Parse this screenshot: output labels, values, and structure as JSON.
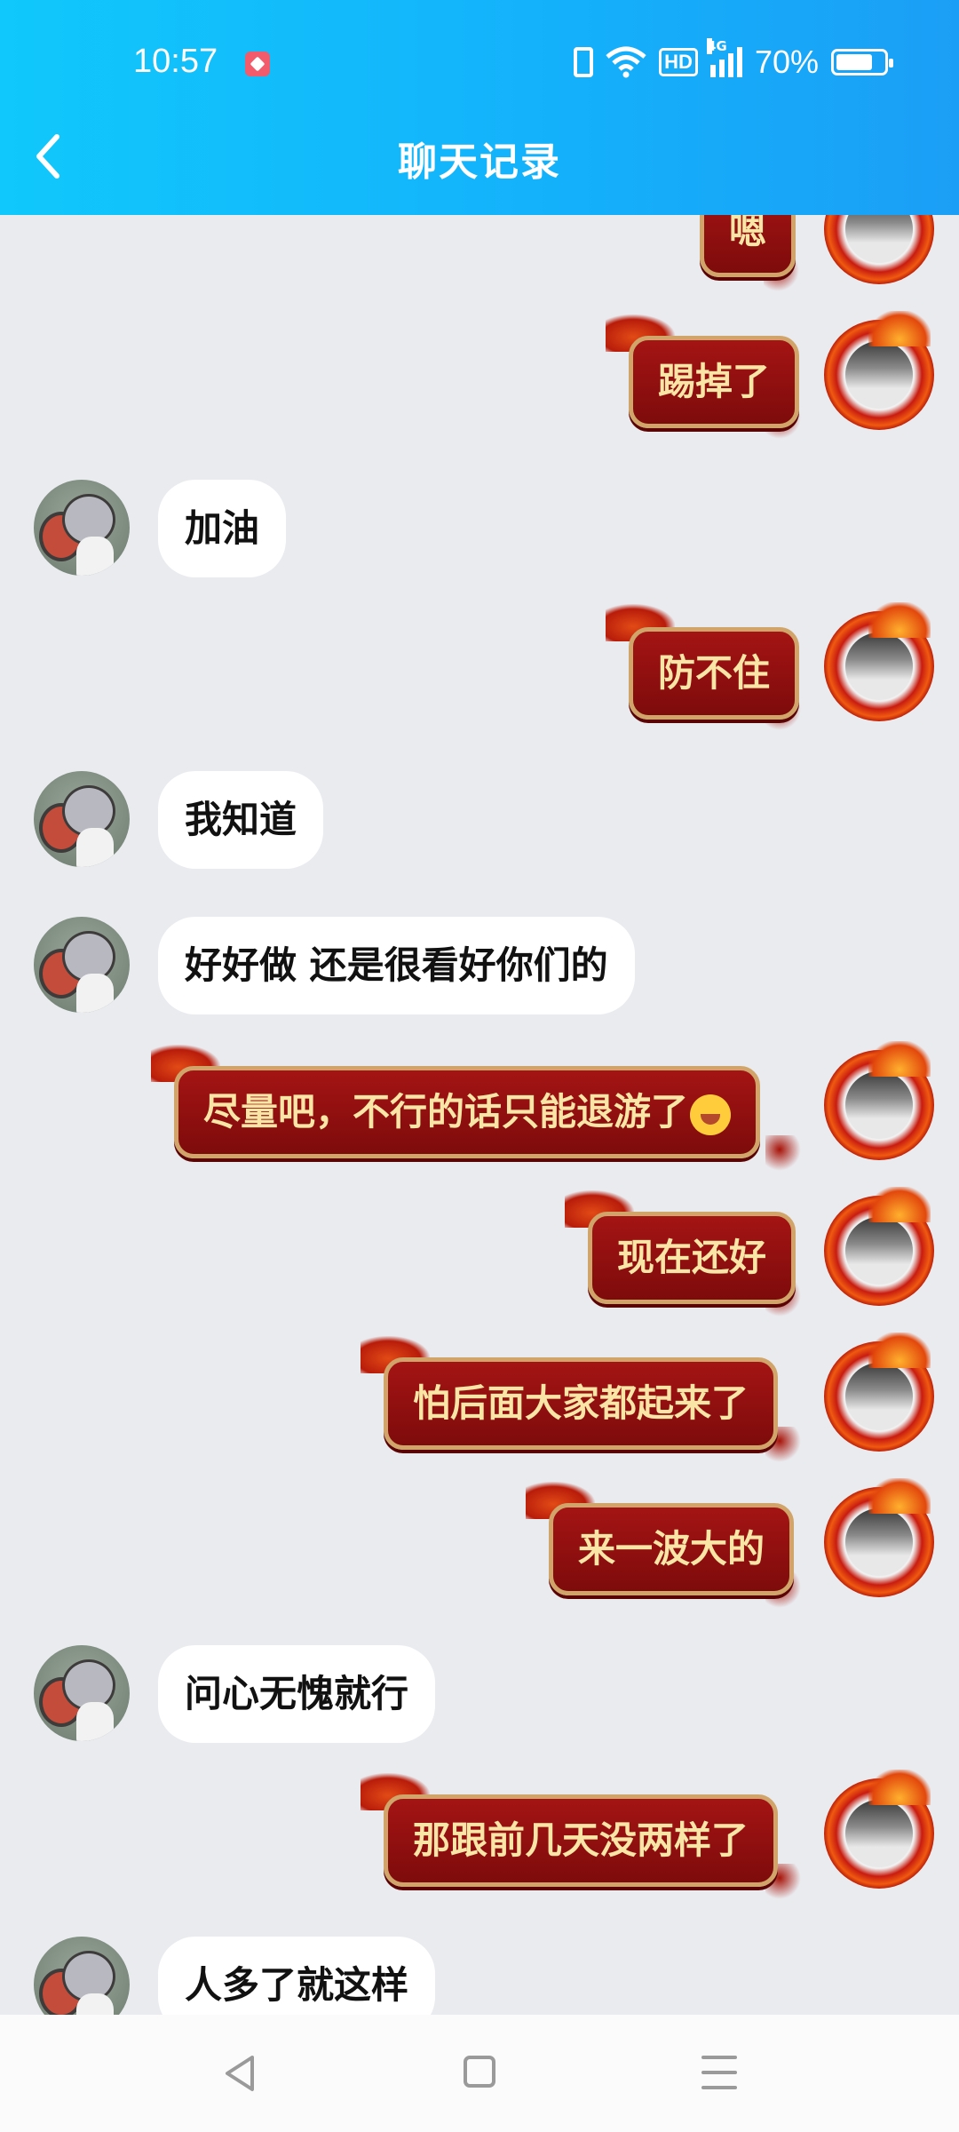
{
  "status_bar": {
    "time": "10:57",
    "network_label": "4G",
    "hd_label": "HD",
    "battery": "70%"
  },
  "header": {
    "title": "聊天记录"
  },
  "messages": [
    {
      "side": "right",
      "text": "嗯"
    },
    {
      "side": "right",
      "text": "踢掉了"
    },
    {
      "side": "left",
      "text": "加油"
    },
    {
      "side": "right",
      "text": "防不住"
    },
    {
      "side": "left",
      "text": "我知道"
    },
    {
      "side": "left",
      "text": "好好做 还是很看好你们的"
    },
    {
      "side": "right",
      "text": "尽量吧，不行的话只能退游了",
      "emoji": "laugh-cry-emoji"
    },
    {
      "side": "right",
      "text": "现在还好"
    },
    {
      "side": "right",
      "text": "怕后面大家都起来了"
    },
    {
      "side": "right",
      "text": "来一波大的"
    },
    {
      "side": "left",
      "text": "问心无愧就行"
    },
    {
      "side": "right",
      "text": "那跟前几天没两样了"
    },
    {
      "side": "left",
      "text": "人多了就这样"
    }
  ],
  "colors": {
    "header": "#14b0fb",
    "bubble_right": "#8e0f0f",
    "bubble_right_text": "#f9e5a6",
    "bubble_left": "#ffffff",
    "background": "#eaebef"
  }
}
